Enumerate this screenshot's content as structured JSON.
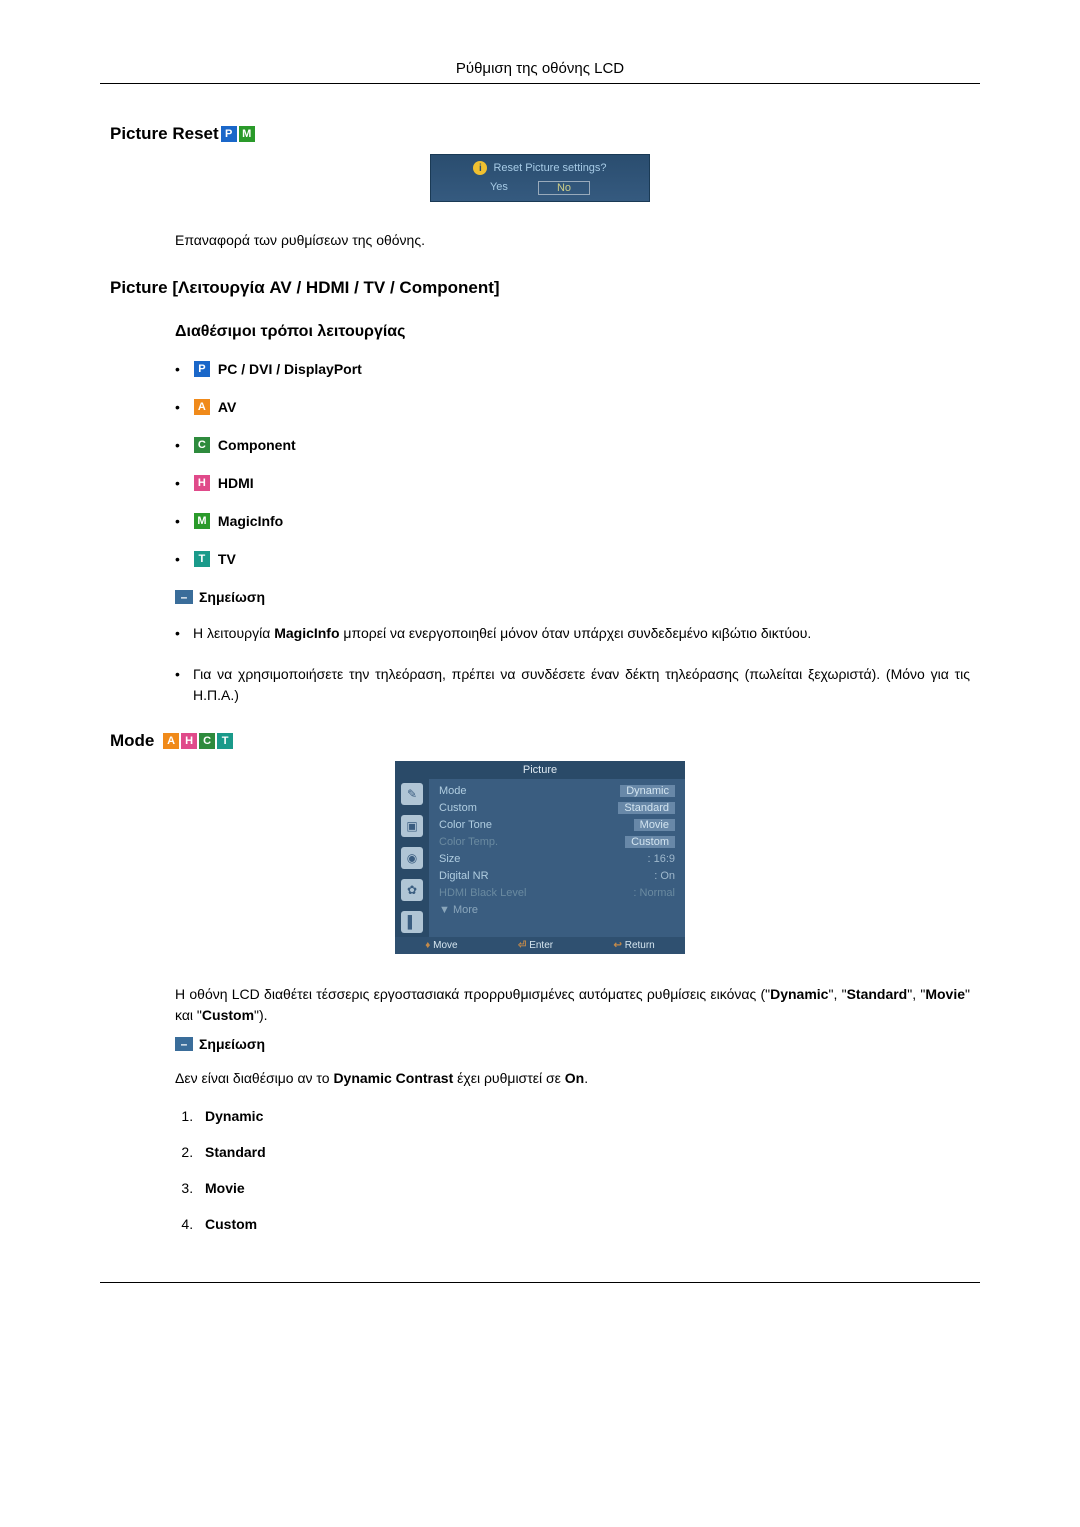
{
  "header": {
    "title": "Ρύθμιση της οθόνης LCD"
  },
  "picture_reset": {
    "title": "Picture Reset",
    "dialog": {
      "message": "Reset Picture settings?",
      "yes": "Yes",
      "no": "No"
    },
    "desc": "Επαναφορά των ρυθμίσεων της οθόνης."
  },
  "picture_av": {
    "heading": "Picture [Λειτουργία AV / HDMI / TV / Component]",
    "subheading": "Διαθέσιμοι τρόποι λειτουργίας",
    "modes": {
      "pc": "PC / DVI / DisplayPort",
      "av": "AV",
      "component": "Component",
      "hdmi": "HDMI",
      "magicinfo": "MagicInfo",
      "tv": "TV"
    },
    "note_label": "Σημείωση",
    "notes": {
      "n1a": "Η λειτουργία ",
      "n1b": "MagicInfo",
      "n1c": " μπορεί να ενεργοποιηθεί μόνον όταν υπάρχει συνδεδεμένο κιβώτιο δικτύου.",
      "n2": "Για να χρησιμοποιήσετε την τηλεόραση, πρέπει να συνδέσετε έναν δέκτη τηλεόρασης (πωλείται ξεχωριστά). (Μόνο για τις Η.Π.Α.)"
    }
  },
  "mode": {
    "title": "Mode",
    "osd": {
      "title": "Picture",
      "rows": {
        "r1l": "Mode",
        "r1v": "Dynamic",
        "r2l": "Custom",
        "r2v": "Standard",
        "r3l": "Color Tone",
        "r3v": "Movie",
        "r4l": "Color Temp.",
        "r4v": "Custom",
        "r5l": "Size",
        "r5v": "16:9",
        "r6l": "Digital NR",
        "r6v": "On",
        "r7l": "HDMI Black Level",
        "r7v": "Normal",
        "more": "▼ More"
      },
      "footer": {
        "move": "Move",
        "enter": "Enter",
        "return": "Return"
      }
    },
    "desc1a": "Η οθόνη LCD διαθέτει τέσσερις εργοστασιακά προρρυθμισμένες αυτόματες ρυθμίσεις εικόνας (\"",
    "desc1b": "Dynamic",
    "desc1c": "\", \"",
    "desc1d": "Standard",
    "desc1e": "\", \"",
    "desc1f": "Movie",
    "desc1g": "\" και \"",
    "desc1h": "Custom",
    "desc1i": "\").",
    "note_label": "Σημείωση",
    "desc2a": "Δεν είναι διαθέσιμο αν το ",
    "desc2b": "Dynamic Contrast",
    "desc2c": " έχει ρυθμιστεί σε ",
    "desc2d": "On",
    "desc2e": ".",
    "list": {
      "l1": "Dynamic",
      "l2": "Standard",
      "l3": "Movie",
      "l4": "Custom"
    }
  }
}
